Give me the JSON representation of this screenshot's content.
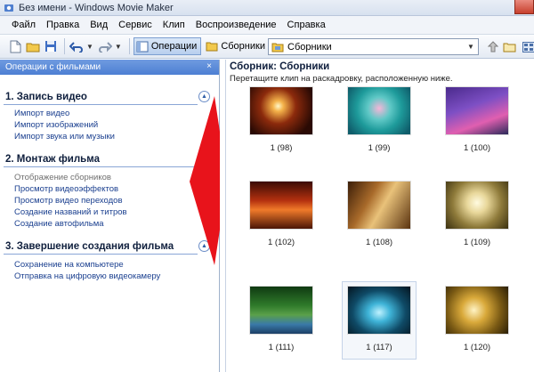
{
  "window": {
    "title": "Без имени - Windows Movie Maker"
  },
  "menu": [
    "Файл",
    "Правка",
    "Вид",
    "Сервис",
    "Клип",
    "Воспроизведение",
    "Справка"
  ],
  "toolbar": {
    "operations_label": "Операции",
    "collections_label": "Сборники",
    "collection_select_value": "Сборники"
  },
  "tasks_pane": {
    "header": "Операции с фильмами",
    "close_glyph": "×",
    "sections": [
      {
        "title": "1. Запись видео",
        "links": [
          "Импорт видео",
          "Импорт изображений",
          "Импорт звука или музыки"
        ]
      },
      {
        "title": "2. Монтаж фильма",
        "links": [
          "Отображение сборников",
          "Просмотр видеоэффектов",
          "Просмотр видео переходов",
          "Создание названий и титров",
          "Создание автофильма"
        ]
      },
      {
        "title": "3. Завершение создания фильма",
        "links": [
          "Сохранение на компьютере",
          "Отправка на цифровую видеокамеру"
        ]
      }
    ]
  },
  "collection": {
    "title": "Сборник: Сборники",
    "subtitle": "Перетащите клип на раскадровку, расположенную ниже.",
    "clips": [
      {
        "label": "1 (98)",
        "selected": false
      },
      {
        "label": "1 (99)",
        "selected": false
      },
      {
        "label": "1 (100)",
        "selected": false
      },
      {
        "label": "1 (102)",
        "selected": false
      },
      {
        "label": "1 (108)",
        "selected": false
      },
      {
        "label": "1 (109)",
        "selected": false
      },
      {
        "label": "1 (111)",
        "selected": false
      },
      {
        "label": "1 (117)",
        "selected": true
      },
      {
        "label": "1 (120)",
        "selected": false
      }
    ]
  },
  "colors": {
    "pane_header": "#5a8ad9",
    "link": "#1a3f8f",
    "arrow": "#e8131b"
  }
}
